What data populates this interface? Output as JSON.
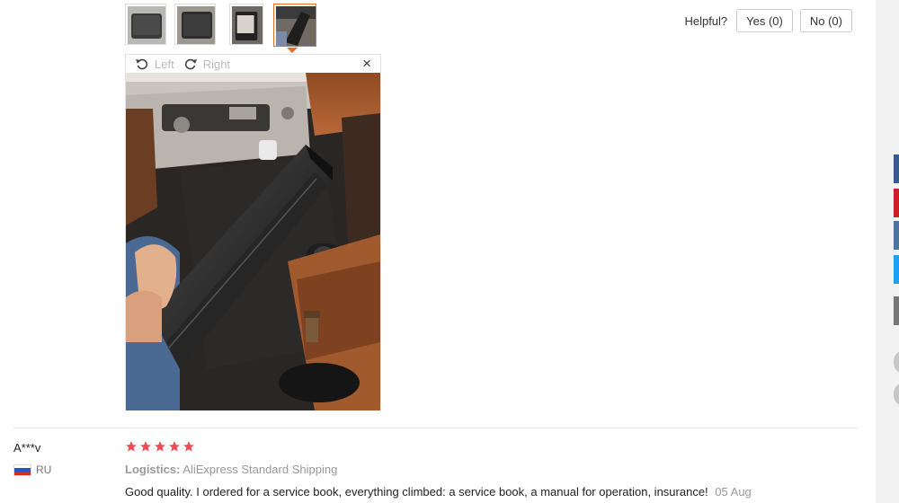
{
  "thumbnails": [
    {
      "label": "wallet-photo-1",
      "color": "#8a8a8a"
    },
    {
      "label": "wallet-photo-2",
      "color": "#7a7a78"
    },
    {
      "label": "wallet-photo-3",
      "color": "#454545"
    },
    {
      "label": "wallet-photo-4",
      "color": "#5c5c5c",
      "active": true
    }
  ],
  "helpful": {
    "label": "Helpful?",
    "yes_label": "Yes (0)",
    "no_label": "No (0)"
  },
  "viewer": {
    "rotate_left_label": "Left",
    "rotate_right_label": "Right",
    "close_glyph": "×",
    "image_icon": "image-icon"
  },
  "review": {
    "author": "A***v",
    "country": "RU",
    "stars": 5,
    "logistics_label": "Logistics:",
    "logistics_value": "AliExpress Standard Shipping",
    "text": "Good quality. I ordered for a service book, everything climbed: a service book, a manual for operation, insurance!",
    "date": "05 Aug"
  },
  "colors": {
    "accent": "#e96c27",
    "star": "#f0484f",
    "facebook": "#3b5998",
    "pinterest": "#cb2027",
    "vk": "#4c75a3",
    "twitter": "#1da1f2"
  }
}
